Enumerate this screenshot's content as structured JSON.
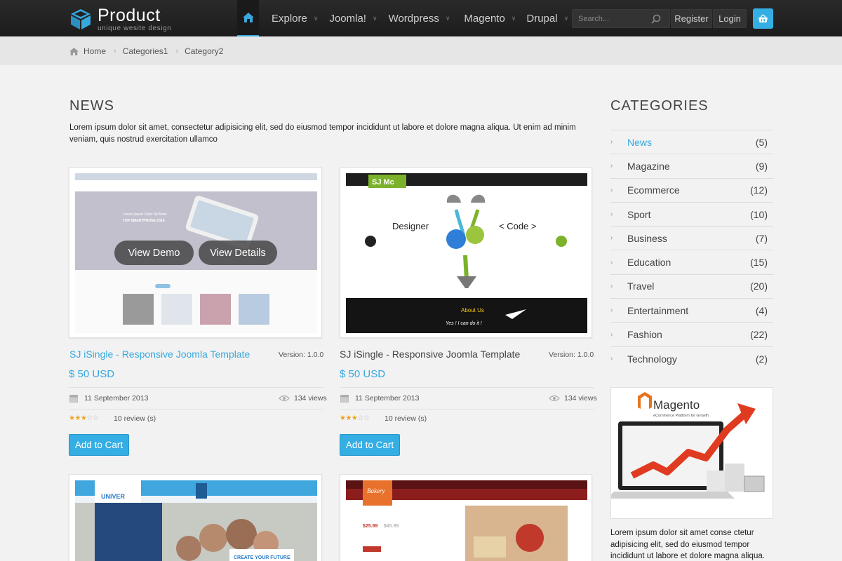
{
  "brand": {
    "name": "Product",
    "tagline": "unique wesite design"
  },
  "nav": {
    "items": [
      "Explore",
      "Joomla!",
      "Wordpress",
      "Magento",
      "Drupal"
    ]
  },
  "search": {
    "placeholder": "Search..."
  },
  "header_buttons": {
    "register": "Register",
    "login": "Login"
  },
  "breadcrumb": [
    "Home",
    "Categories1",
    "Category2"
  ],
  "main": {
    "title": "NEWS",
    "intro": "Lorem ipsum dolor sit amet, consectetur adipisicing elit, sed do eiusmod tempor incididunt ut labore et dolore magna aliqua. Ut enim ad minim veniam, quis nostrud exercitation ullamco"
  },
  "products": [
    {
      "title": "SJ iSingle - Responsive Joomla Template",
      "version": "Version: 1.0.0",
      "price": "$ 50 USD",
      "date": "11 September 2013",
      "views": "134 views",
      "reviews": "10 review (s)",
      "rating": 3,
      "cart": "Add to Cart",
      "overlay_demo": "View Demo",
      "overlay_details": "View Details",
      "shot_texts": [
        "Lorem Ipsum Dolor Sit Amet",
        "TOP SMARTPHONE 2014"
      ]
    },
    {
      "title": "SJ iSingle - Responsive Joomla Template",
      "version": "Version: 1.0.0",
      "price": "$ 50 USD",
      "date": "11 September 2013",
      "views": "134 views",
      "reviews": "10 review (s)",
      "rating": 3,
      "cart": "Add to Cart",
      "shot_texts": [
        "SJ Mc",
        "Designer",
        "< Code >",
        "About Us",
        "Yes ! I can do it !"
      ]
    }
  ],
  "thumbs": [
    {
      "texts": [
        "UNIVER",
        "CREATE YOUR FUTURE"
      ]
    },
    {
      "texts": [
        "Bakery",
        "$25.89",
        "$45.89"
      ]
    }
  ],
  "sidebar": {
    "title": "CATEGORIES",
    "categories": [
      {
        "label": "News",
        "count": "(5)"
      },
      {
        "label": "Magazine",
        "count": "(9)"
      },
      {
        "label": "Ecommerce",
        "count": "(12)"
      },
      {
        "label": "Sport",
        "count": "(10)"
      },
      {
        "label": "Business",
        "count": "(7)"
      },
      {
        "label": "Education",
        "count": "(15)"
      },
      {
        "label": "Travel",
        "count": "(20)"
      },
      {
        "label": "Entertainment",
        "count": "(4)"
      },
      {
        "label": "Fashion",
        "count": "(22)"
      },
      {
        "label": "Technology",
        "count": "(2)"
      }
    ],
    "ad_texts": [
      "Magento",
      "eCommerce Platform for Growth"
    ],
    "text": "Lorem ipsum dolor sit amet conse ctetur adipisicing elit, sed do eiusmod tempor incididunt ut labore et dolore magna aliqua. tion ullamco ex ea"
  },
  "colors": {
    "accent": "#35a8de",
    "header": "#222222",
    "star": "#f0a020",
    "background": "#f2f2f2"
  }
}
